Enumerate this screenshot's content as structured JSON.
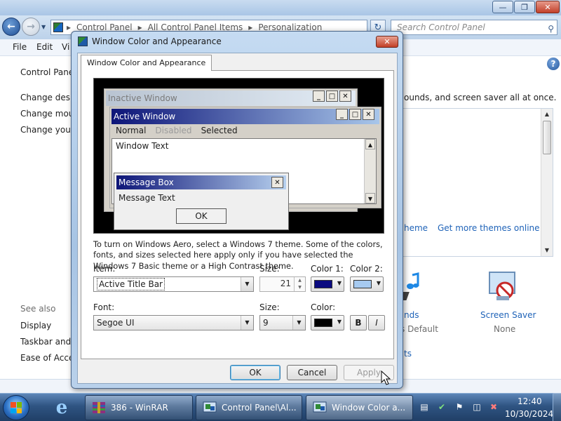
{
  "control_panel": {
    "breadcrumb": [
      "Control Panel",
      "All Control Panel Items",
      "Personalization"
    ],
    "search_placeholder": "Search Control Panel",
    "menu": [
      "File",
      "Edit",
      "Vi"
    ],
    "sidebar": {
      "home": "Control Panel",
      "links": [
        "Change deskt",
        "Change mous",
        "Change your"
      ],
      "see_also": "See also",
      "see_also_links": [
        "Display",
        "Taskbar and S",
        "Ease of Acces"
      ]
    },
    "description": "ounds, and screen saver all at once.",
    "theme_links": {
      "theme_partial": "heme",
      "get_more": "Get more themes online"
    },
    "sounds": {
      "label": "nds",
      "sub": "s Default"
    },
    "screen_saver": {
      "label": "Screen Saver",
      "sub": "None"
    },
    "partial_link": "ts"
  },
  "dialog": {
    "title": "Window Color and Appearance",
    "tab": "Window Color and Appearance",
    "preview": {
      "inactive_title": "Inactive Window",
      "active_title": "Active Window",
      "menu": [
        "Normal",
        "Disabled",
        "Selected"
      ],
      "window_text": "Window Text",
      "message_box_title": "Message Box",
      "message_text": "Message Text",
      "ok": "OK"
    },
    "info": "To turn on Windows Aero, select a Windows 7 theme.  Some of the colors, fonts, and sizes selected here apply only if you have selected the Windows 7 Basic theme or a High Contrast theme.",
    "labels": {
      "item": "Item:",
      "size": "Size:",
      "color1": "Color 1:",
      "color2": "Color 2:",
      "font": "Font:",
      "size_font": "Size:",
      "color": "Color:"
    },
    "item_value": "Active Title Bar",
    "item_size": "21",
    "font_value": "Segoe UI",
    "font_size": "9",
    "bold": "B",
    "italic": "I",
    "buttons": {
      "ok": "OK",
      "cancel": "Cancel",
      "apply": "Apply"
    },
    "colors": {
      "color1": "#0a0a80",
      "color2": "#a6caf0",
      "font_color": "#000000"
    }
  },
  "taskbar": {
    "items": [
      "386 - WinRAR",
      "Control Panel\\Al...",
      "Window Color a..."
    ],
    "time": "12:40",
    "date": "10/30/2024"
  }
}
